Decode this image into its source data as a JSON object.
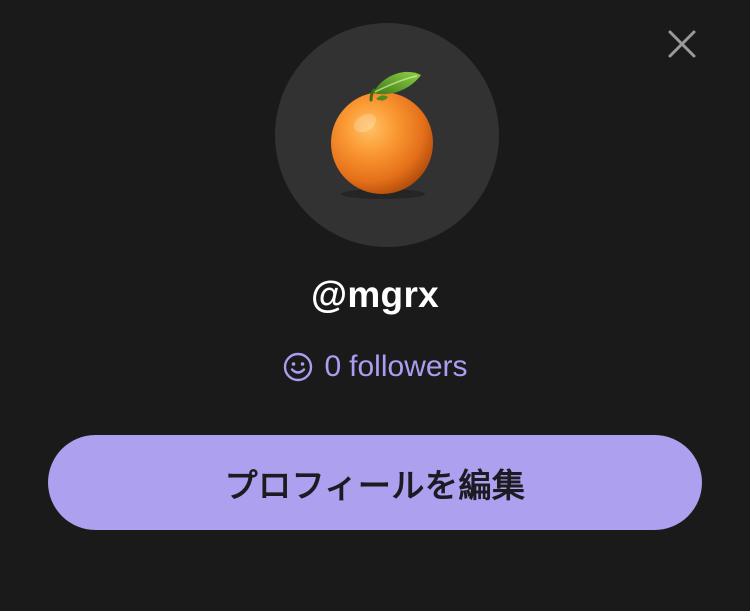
{
  "profile": {
    "username": "@mgrx",
    "followers_count": "0",
    "followers_label": "followers",
    "avatar_icon": "orange-emoji"
  },
  "actions": {
    "edit_profile_label": "プロフィールを編集",
    "close_icon": "close-icon"
  },
  "colors": {
    "background": "#1a1a1b",
    "avatar_bg": "#323233",
    "accent": "#aca0ef",
    "followers_text": "#a99ef0",
    "button_text": "#1c1b22"
  }
}
